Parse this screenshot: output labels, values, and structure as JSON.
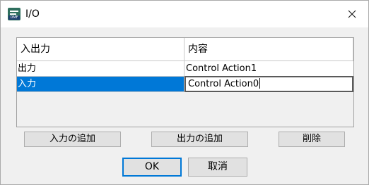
{
  "window": {
    "title": "I/O",
    "icon_name": "app-io-icon",
    "icon_tag": "DMF",
    "close_icon": "close-icon"
  },
  "table": {
    "headers": [
      "入出力",
      "内容"
    ],
    "rows": [
      {
        "io": "出力",
        "content": "Control Action1"
      },
      {
        "io": "入力",
        "content": "Control Action0",
        "selected": true,
        "editing": true
      }
    ]
  },
  "buttons": {
    "add_input": "入力の追加",
    "add_output": "出力の追加",
    "delete": "削除",
    "ok": "OK",
    "cancel": "取消"
  },
  "colors": {
    "selection": "#0078d7",
    "default_button_border": "#0078d7",
    "background": "#f0f0f0"
  }
}
